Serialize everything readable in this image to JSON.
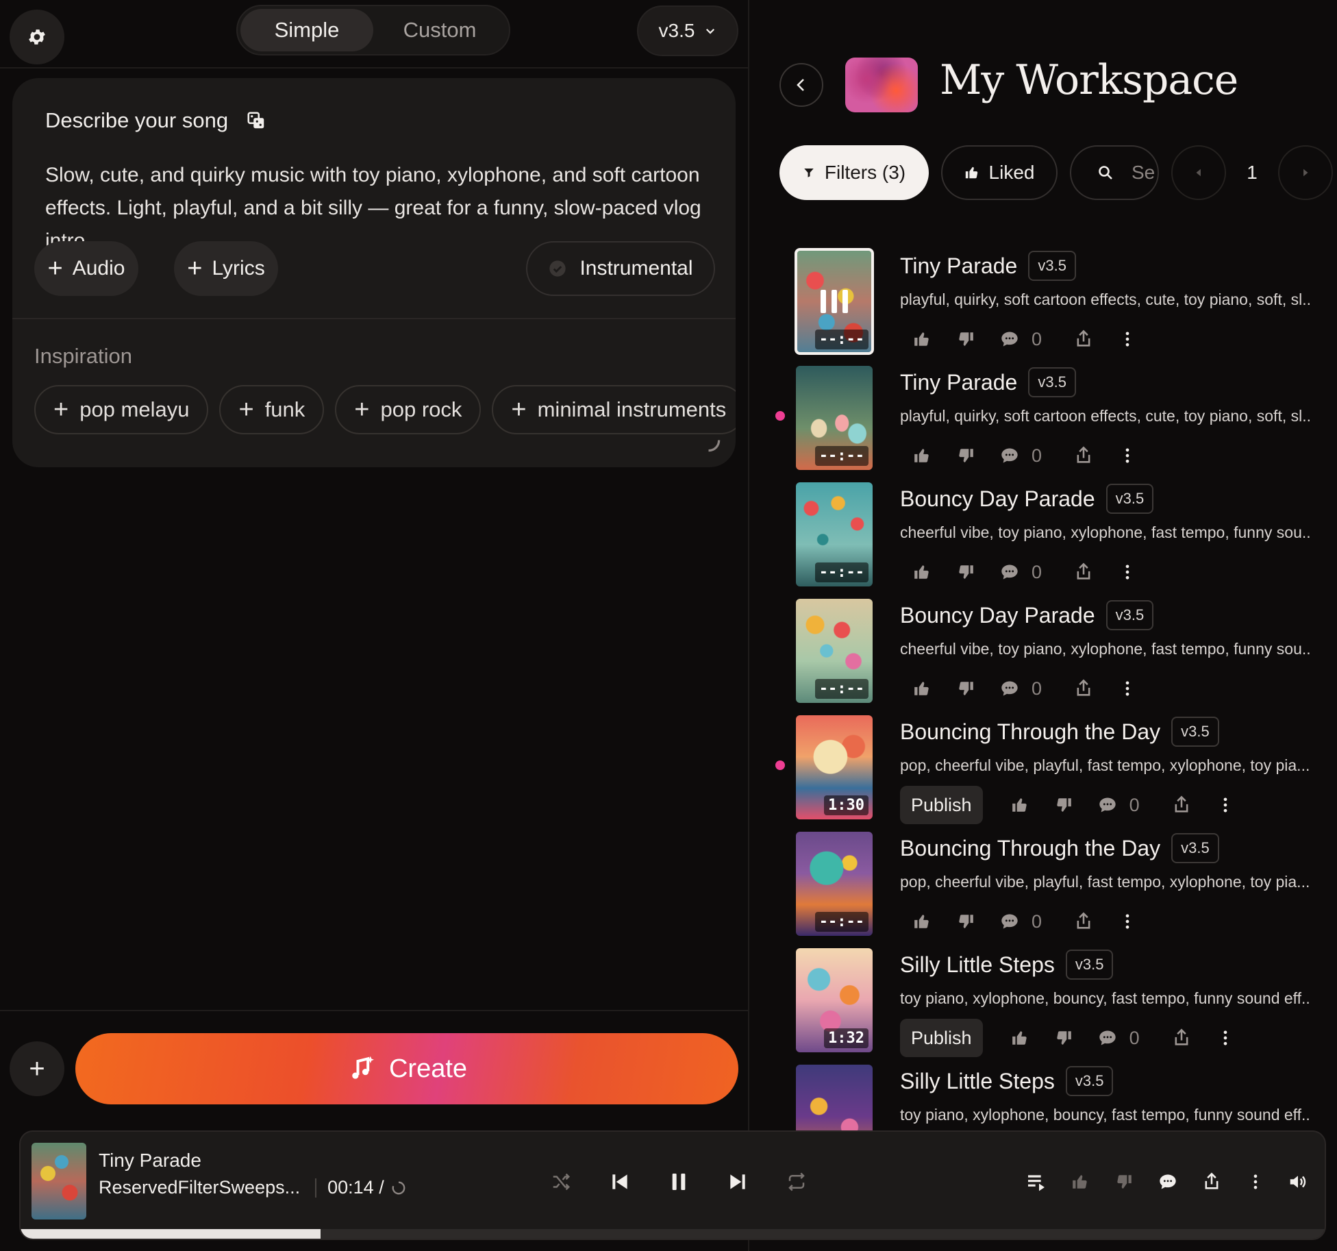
{
  "mode_tabs": [
    "Simple",
    "Custom"
  ],
  "active_mode": "Simple",
  "version_select": "v3.5",
  "prompt_card": {
    "title": "Describe your song",
    "description": "Slow, cute, and quirky music with toy piano, xylophone, and soft cartoon effects. Light, playful, and a bit silly — great for a funny, slow-paced vlog intro",
    "audio_label": "Audio",
    "lyrics_label": "Lyrics",
    "instrumental_label": "Instrumental"
  },
  "inspiration": {
    "label": "Inspiration",
    "tags": [
      "pop melayu",
      "funk",
      "pop rock",
      "minimal instruments"
    ]
  },
  "create_label": "Create",
  "workspace": {
    "title": "My Workspace",
    "filters_label": "Filters (3)",
    "liked_label": "Liked",
    "search_placeholder": "Se",
    "page": "1"
  },
  "songs": [
    {
      "title": "Tiny Parade",
      "version": "v3.5",
      "tags": "playful, quirky, soft cartoon effects, cute, toy piano, soft, sl...",
      "duration": "--:--",
      "comments": "0",
      "publish": "",
      "dot": false,
      "playing": true
    },
    {
      "title": "Tiny Parade",
      "version": "v3.5",
      "tags": "playful, quirky, soft cartoon effects, cute, toy piano, soft, sl...",
      "duration": "--:--",
      "comments": "0",
      "publish": "",
      "dot": true,
      "playing": false
    },
    {
      "title": "Bouncy Day Parade",
      "version": "v3.5",
      "tags": "cheerful vibe, toy piano, xylophone, fast tempo, funny sou...",
      "duration": "--:--",
      "comments": "0",
      "publish": "",
      "dot": false,
      "playing": false
    },
    {
      "title": "Bouncy Day Parade",
      "version": "v3.5",
      "tags": "cheerful vibe, toy piano, xylophone, fast tempo, funny sou...",
      "duration": "--:--",
      "comments": "0",
      "publish": "",
      "dot": false,
      "playing": false
    },
    {
      "title": "Bouncing Through the Day",
      "version": "v3.5",
      "tags": "pop, cheerful vibe, playful, fast tempo, xylophone, toy pia...",
      "duration": "1:30",
      "comments": "0",
      "publish": "Publish",
      "dot": true,
      "playing": false
    },
    {
      "title": "Bouncing Through the Day",
      "version": "v3.5",
      "tags": "pop, cheerful vibe, playful, fast tempo, xylophone, toy pia...",
      "duration": "--:--",
      "comments": "0",
      "publish": "",
      "dot": false,
      "playing": false
    },
    {
      "title": "Silly Little Steps",
      "version": "v3.5",
      "tags": "toy piano, xylophone, bouncy, fast tempo, funny sound eff...",
      "duration": "1:32",
      "comments": "0",
      "publish": "Publish",
      "dot": false,
      "playing": false
    },
    {
      "title": "Silly Little Steps",
      "version": "v3.5",
      "tags": "toy piano, xylophone, bouncy, fast tempo, funny sound eff...",
      "duration": "",
      "comments": "",
      "publish": "",
      "dot": false,
      "playing": false
    }
  ],
  "player": {
    "title": "Tiny Parade",
    "artist": "ReservedFilterSweeps...",
    "time": "00:14 /",
    "progress": 0.23
  },
  "colors": {
    "accent_dot": "#ee3e93",
    "create_gradient_start": "#f26a1f",
    "create_gradient_mid": "#e0427a"
  }
}
